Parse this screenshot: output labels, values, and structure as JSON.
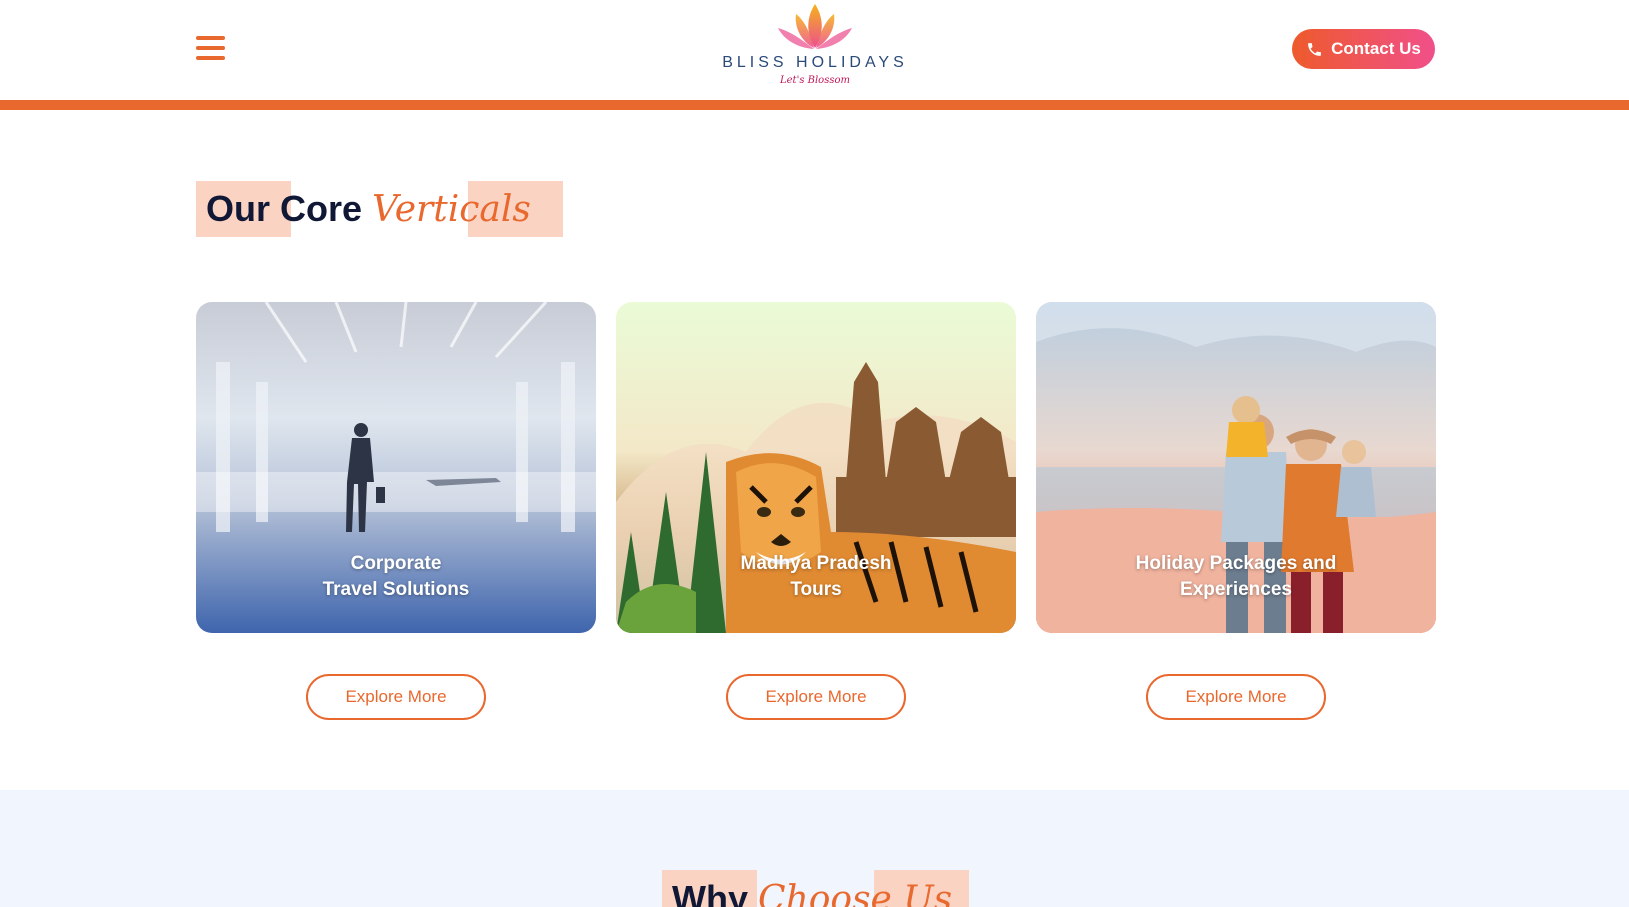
{
  "header": {
    "brand_name": "BLISS HOLIDAYS",
    "brand_tagline": "Let's Blossom",
    "contact_label": "Contact Us",
    "accent_color": "#e8682e"
  },
  "core_section": {
    "title_plain": "Our Core",
    "title_script": "Verticals"
  },
  "cards": [
    {
      "label": "Corporate\nTravel Solutions",
      "button": "Explore More"
    },
    {
      "label": "Madhya Pradesh\nTours",
      "button": "Explore More"
    },
    {
      "label": "Holiday Packages and\nExperiences",
      "button": "Explore More"
    }
  ],
  "why_section": {
    "title_plain": "Why",
    "title_script": "Choose Us"
  },
  "icons": [
    "menu-icon",
    "lotus-logo-icon",
    "phone-icon"
  ]
}
